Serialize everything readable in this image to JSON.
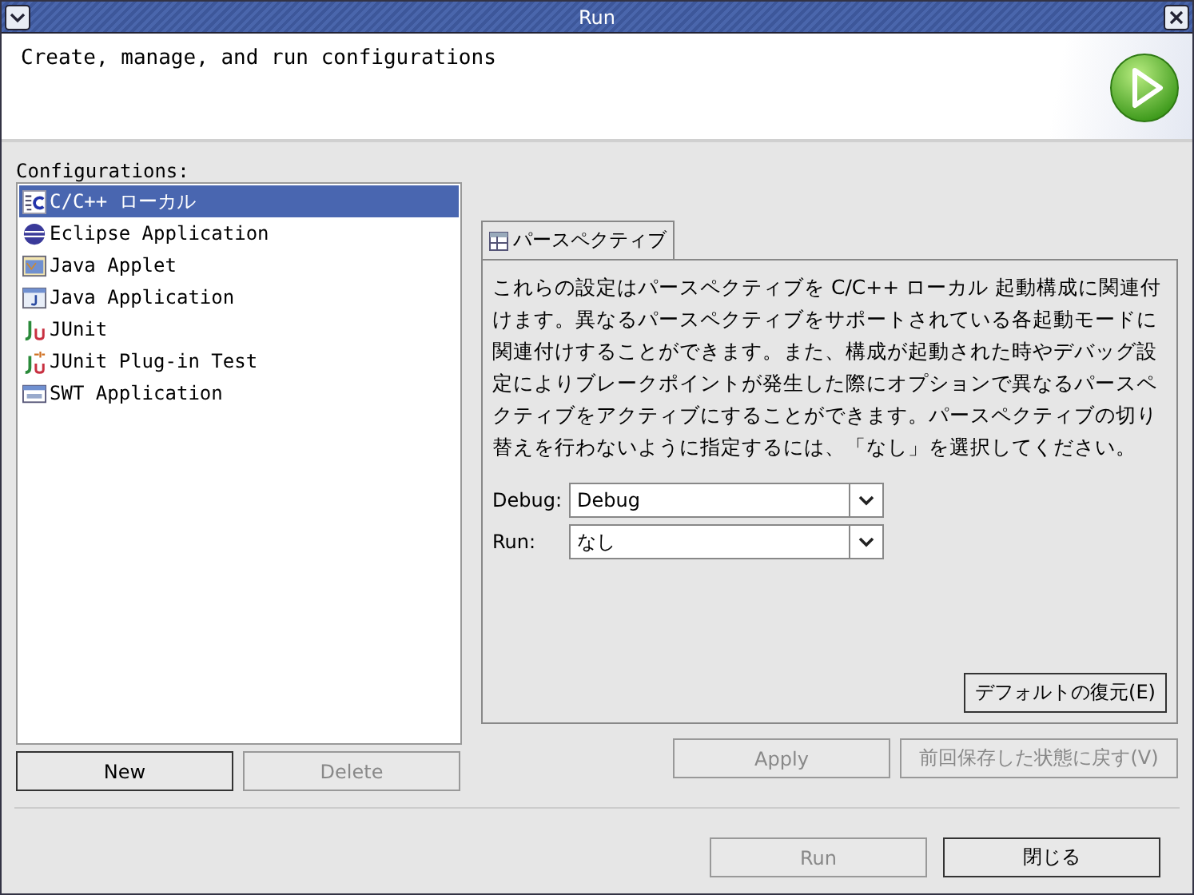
{
  "window": {
    "title": "Run"
  },
  "header": {
    "message": "Create, manage, and run configurations"
  },
  "configurations": {
    "label": "Configurations:",
    "items": [
      {
        "label": "C/C++ ローカル",
        "kind": "c",
        "selected": true
      },
      {
        "label": "Eclipse Application",
        "kind": "eclipse",
        "selected": false
      },
      {
        "label": "Java Applet",
        "kind": "applet",
        "selected": false
      },
      {
        "label": "Java Application",
        "kind": "java",
        "selected": false
      },
      {
        "label": "JUnit",
        "kind": "junit",
        "selected": false
      },
      {
        "label": "JUnit Plug-in Test",
        "kind": "plugin",
        "selected": false
      },
      {
        "label": "SWT Application",
        "kind": "swt",
        "selected": false
      }
    ],
    "buttons": [
      {
        "label": "New",
        "disabled": false
      },
      {
        "label": "Delete",
        "disabled": true
      }
    ]
  },
  "tabs": [
    {
      "label": "パースペクティブ",
      "selected": true
    }
  ],
  "perspective": {
    "description": "これらの設定はパースペクティブを C/C++ ローカル 起動構成に関連付けます。異なるパースペクティブをサポートされている各起動モードに関連付けすることができます。また、構成が起動された時やデバッグ設定によりブレークポイントが発生した際にオプションで異なるパースペクティブをアクティブにすることができます。パースペクティブの切り替えを行わないように指定するには、「なし」を選択してください。",
    "fields": [
      {
        "label": "Debug:",
        "value": "Debug"
      },
      {
        "label": "Run:",
        "value": "なし"
      }
    ],
    "restore_button": {
      "label": "デフォルトの復元(E)",
      "disabled": false
    }
  },
  "edit_buttons": [
    {
      "label": "Apply",
      "disabled": true
    },
    {
      "label": "前回保存した状態に戻す(V)",
      "disabled": true
    }
  ],
  "dialog_buttons": [
    {
      "label": "Run",
      "disabled": true
    },
    {
      "label": "閉じる",
      "disabled": false
    }
  ]
}
